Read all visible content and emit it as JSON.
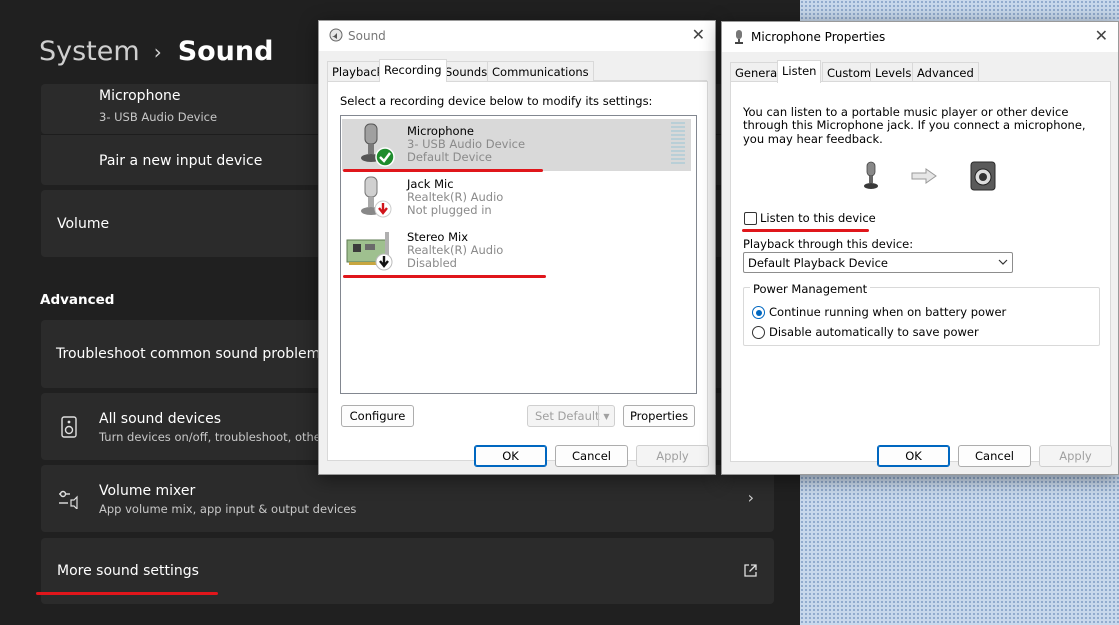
{
  "settings": {
    "breadcrumb": {
      "parent": "System",
      "separator": "›",
      "current": "Sound"
    },
    "microphone": {
      "title": "Microphone",
      "subtitle": "3- USB Audio Device"
    },
    "pair": {
      "title": "Pair a new input device"
    },
    "volume": {
      "title": "Volume"
    },
    "advanced_label": "Advanced",
    "troubleshoot": {
      "title": "Troubleshoot common sound problems"
    },
    "all_devices": {
      "title": "All sound devices",
      "subtitle": "Turn devices on/off, troubleshoot, other"
    },
    "mixer": {
      "title": "Volume mixer",
      "subtitle": "App volume mix, app input & output devices"
    },
    "more": {
      "title": "More sound settings"
    }
  },
  "sound_dialog": {
    "title": "Sound",
    "tabs": [
      "Playback",
      "Recording",
      "Sounds",
      "Communications"
    ],
    "active_tab": "Recording",
    "instruction": "Select a recording device below to modify its settings:",
    "devices": [
      {
        "name": "Microphone",
        "driver": "3- USB Audio Device",
        "status": "Default Device"
      },
      {
        "name": "Jack Mic",
        "driver": "Realtek(R) Audio",
        "status": "Not plugged in"
      },
      {
        "name": "Stereo Mix",
        "driver": "Realtek(R) Audio",
        "status": "Disabled"
      }
    ],
    "buttons": {
      "configure": "Configure",
      "set_default": "Set Default",
      "properties": "Properties",
      "ok": "OK",
      "cancel": "Cancel",
      "apply": "Apply"
    }
  },
  "mic_props": {
    "title": "Microphone Properties",
    "tabs": [
      "General",
      "Listen",
      "Custom",
      "Levels",
      "Advanced"
    ],
    "active_tab": "Listen",
    "description": "You can listen to a portable music player or other device through this Microphone jack.  If you connect a microphone, you may hear feedback.",
    "listen_checkbox": "Listen to this device",
    "playback_label": "Playback through this device:",
    "playback_value": "Default Playback Device",
    "power": {
      "legend": "Power Management",
      "option1": "Continue running when on battery power",
      "option2": "Disable automatically to save power"
    },
    "buttons": {
      "ok": "OK",
      "cancel": "Cancel",
      "apply": "Apply"
    }
  }
}
